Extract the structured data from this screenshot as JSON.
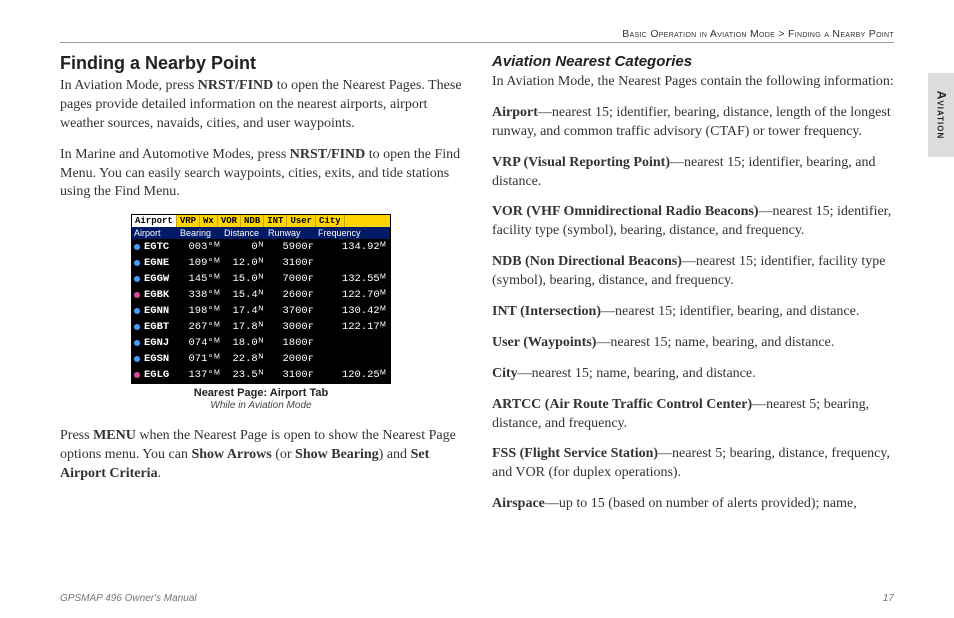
{
  "breadcrumb": {
    "a": "Basic Operation in Aviation Mode",
    "sep": " > ",
    "b": "Finding a Nearby Point"
  },
  "sidetab": "Aviation",
  "left": {
    "heading": "Finding a Nearby Point",
    "p1a": "In Aviation Mode, press ",
    "p1b": "NRST/FIND",
    "p1c": " to open the Nearest Pages. These pages provide detailed information on the nearest airports, airport weather sources, navaids, cities, and user waypoints.",
    "p2a": "In Marine and Automotive Modes, press ",
    "p2b": "NRST/FIND",
    "p2c": " to open the Find Menu. You can easily search waypoints, cities, exits, and tide stations using the Find Menu.",
    "caption1": "Nearest Page: Airport Tab",
    "caption2": "While in Aviation Mode",
    "p3a": "Press ",
    "p3b": "MENU",
    "p3c": " when the Nearest Page is open to show the Nearest Page options menu. You can ",
    "p3d": "Show Arrows",
    "p3e": " (or ",
    "p3f": "Show Bearing",
    "p3g": ") and ",
    "p3h": "Set Airport Criteria",
    "p3i": "."
  },
  "right": {
    "subheading": "Aviation Nearest Categories",
    "intro": "In Aviation Mode, the Nearest Pages contain the following information:",
    "items": {
      "airport_t": "Airport",
      "airport": "—nearest 15; identifier, bearing, distance, length of the longest runway, and common traffic advisory (CTAF) or tower frequency.",
      "vrp_t": "VRP (Visual Reporting Point)",
      "vrp": "—nearest 15; identifier, bearing, and distance.",
      "vor_t": "VOR (VHF Omnidirectional Radio Beacons)",
      "vor": "—nearest 15; identifier, facility type (symbol), bearing, distance, and frequency.",
      "ndb_t": "NDB (Non Directional Beacons)",
      "ndb": "—nearest 15; identifier, facility type (symbol), bearing, distance, and frequency.",
      "int_t": "INT (Intersection)",
      "int": "—nearest 15; identifier, bearing, and distance.",
      "user_t": "User (Waypoints)",
      "user": "—nearest 15; name, bearing, and distance.",
      "city_t": "City",
      "city": "—nearest 15; name, bearing, and distance.",
      "artcc_t": "ARTCC (Air Route Traffic Control Center)",
      "artcc": "—nearest 5; bearing, distance, and frequency.",
      "fss_t": "FSS (Flight Service Station)",
      "fss": "—nearest 5; bearing, distance, frequency, and VOR (for duplex operations).",
      "airspace_t": "Airspace",
      "airspace": "—up to 15 (based on number of alerts provided); name,"
    }
  },
  "footer": {
    "left": "GPSMAP 496 Owner's Manual",
    "right": "17"
  },
  "chart_data": {
    "type": "table",
    "tabs": [
      "Airport",
      "VRP",
      "Wx",
      "VOR",
      "NDB",
      "INT",
      "User",
      "City"
    ],
    "selected_tab": "Airport",
    "columns": [
      "Airport",
      "Bearing",
      "Distance",
      "Runway",
      "Frequency"
    ],
    "rows": [
      {
        "dot": "b",
        "id": "EGTC",
        "bearing": "003°ᴹ",
        "distance": "0ᴺ",
        "runway": "5900ғ",
        "freq": "134.92ᴹ"
      },
      {
        "dot": "b",
        "id": "EGNE",
        "bearing": "109°ᴹ",
        "distance": "12.0ᴺ",
        "runway": "3100ғ",
        "freq": ""
      },
      {
        "dot": "b",
        "id": "EGGW",
        "bearing": "145°ᴹ",
        "distance": "15.0ᴺ",
        "runway": "7000ғ",
        "freq": "132.55ᴹ"
      },
      {
        "dot": "m",
        "id": "EGBK",
        "bearing": "338°ᴹ",
        "distance": "15.4ᴺ",
        "runway": "2600ғ",
        "freq": "122.70ᴹ"
      },
      {
        "dot": "b",
        "id": "EGNN",
        "bearing": "198°ᴹ",
        "distance": "17.4ᴺ",
        "runway": "3700ғ",
        "freq": "130.42ᴹ"
      },
      {
        "dot": "b",
        "id": "EGBT",
        "bearing": "267°ᴹ",
        "distance": "17.8ᴺ",
        "runway": "3000ғ",
        "freq": "122.17ᴹ"
      },
      {
        "dot": "b",
        "id": "EGNJ",
        "bearing": "074°ᴹ",
        "distance": "18.0ᴺ",
        "runway": "1800ғ",
        "freq": ""
      },
      {
        "dot": "b",
        "id": "EGSN",
        "bearing": "071°ᴹ",
        "distance": "22.8ᴺ",
        "runway": "2000ғ",
        "freq": ""
      },
      {
        "dot": "m",
        "id": "EGLG",
        "bearing": "137°ᴹ",
        "distance": "23.5ᴺ",
        "runway": "3100ғ",
        "freq": "120.25ᴹ"
      }
    ]
  }
}
